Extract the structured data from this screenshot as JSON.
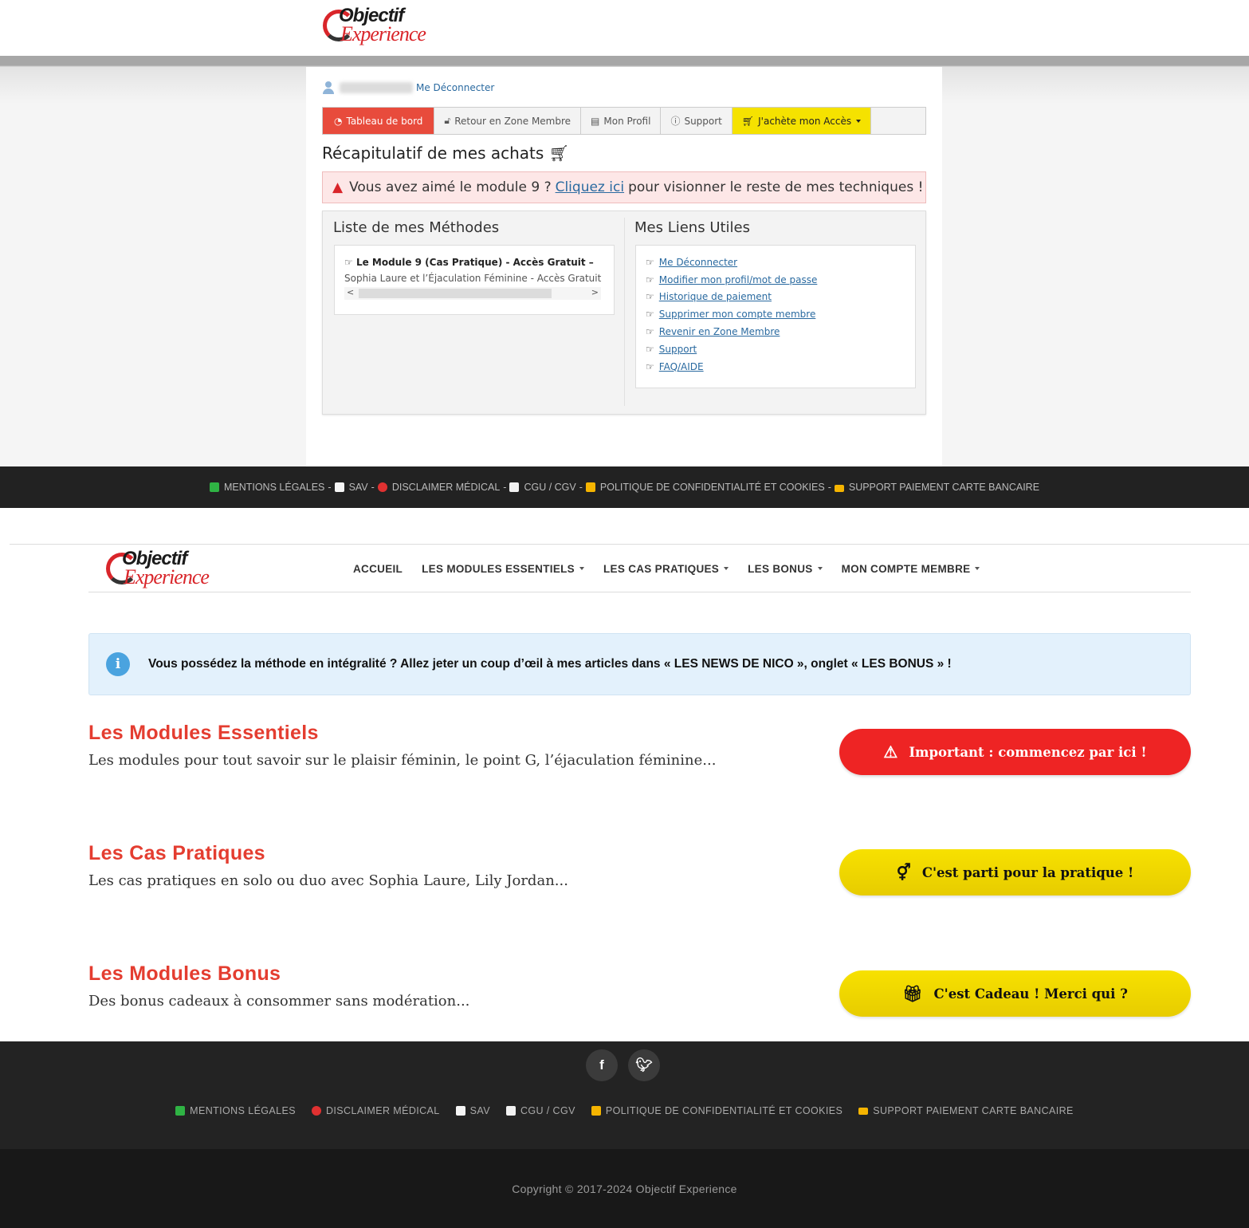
{
  "brand": {
    "logo_word1": "Objectif",
    "logo_word2": "Experience",
    "accent_color": "#e43d30"
  },
  "member_area": {
    "user": {
      "logout_label": "Me Déconnecter"
    },
    "tabs": [
      {
        "label": "Tableau de bord",
        "icon": "dashboard-icon",
        "active": true
      },
      {
        "label": "Retour en Zone Membre",
        "icon": "lock-icon"
      },
      {
        "label": "Mon Profil",
        "icon": "id-card-icon"
      },
      {
        "label": "Support",
        "icon": "help-icon"
      },
      {
        "label": "J'achète mon Accès",
        "icon": "cart-icon",
        "dropdown": true
      }
    ],
    "recap_title": "Récapitulatif de mes achats",
    "alert": {
      "before": "Vous avez aimé le module 9 ?",
      "link": "Cliquez ici",
      "after": "pour visionner le reste de mes techniques !"
    },
    "methods": {
      "title": "Liste de mes Méthodes",
      "item_title": "Le Module 9 (Cas Pratique) - Accès Gratuit –",
      "item_sub": "Sophia Laure et l’Éjaculation Féminine - Accès Gratuit"
    },
    "links": {
      "title": "Mes Liens Utiles",
      "items": [
        "Me Déconnecter",
        "Modifier mon profil/mot de passe",
        "Historique de paiement",
        "Supprimer mon compte membre",
        "Revenir en Zone Membre",
        "Support",
        "FAQ/AIDE"
      ]
    }
  },
  "footer_top": {
    "links": [
      {
        "label": "MENTIONS LÉGALES",
        "color": "#2fb344"
      },
      {
        "label": "SAV",
        "color": "#ffffff"
      },
      {
        "label": "DISCLAIMER MÉDICAL",
        "color": "#e03131"
      },
      {
        "label": "CGU / CGV",
        "color": "#f1f1f1"
      },
      {
        "label": "POLITIQUE DE CONFIDENTIALITÉ ET COOKIES",
        "color": "#f5b400"
      },
      {
        "label": "SUPPORT PAIEMENT CARTE BANCAIRE",
        "color": "#f5b400"
      }
    ]
  },
  "nav": {
    "items": [
      {
        "label": "ACCUEIL",
        "dropdown": false
      },
      {
        "label": "LES MODULES ESSENTIELS",
        "dropdown": true
      },
      {
        "label": "LES CAS PRATIQUES",
        "dropdown": true
      },
      {
        "label": "LES BONUS",
        "dropdown": true
      },
      {
        "label": "MON COMPTE MEMBRE",
        "dropdown": true
      }
    ]
  },
  "info_banner": "Vous possédez la méthode en intégralité ? Allez jeter un coup d’œil à mes articles dans « LES NEWS DE NICO », onglet « LES BONUS » !",
  "sections": [
    {
      "title": "Les Modules Essentiels",
      "desc": "Les modules pour tout savoir sur le plaisir féminin, le point G, l’éjaculation féminine...",
      "button": "Important : commencez par ici !",
      "button_icon": "warning-icon",
      "button_color": "#ee2424"
    },
    {
      "title": "Les Cas Pratiques",
      "desc": "Les cas pratiques en solo ou duo avec Sophia Laure, Lily Jordan...",
      "button": "C'est parti pour la pratique !",
      "button_icon": "gender-icon",
      "button_color": "#f0d800"
    },
    {
      "title": "Les Modules Bonus",
      "desc": "Des bonus cadeaux à consommer sans modération...",
      "button": "C'est Cadeau ! Merci qui ?",
      "button_icon": "gift-icon",
      "button_color": "#f0d800"
    }
  ],
  "footer_bottom": {
    "socials": [
      "facebook-icon",
      "twitter-icon"
    ],
    "links": [
      {
        "label": "MENTIONS LÉGALES",
        "color": "#2fb344"
      },
      {
        "label": "DISCLAIMER MÉDICAL",
        "color": "#e03131"
      },
      {
        "label": "SAV",
        "color": "#ffffff"
      },
      {
        "label": "CGU / CGV",
        "color": "#f1f1f1"
      },
      {
        "label": "POLITIQUE DE CONFIDENTIALITÉ ET COOKIES",
        "color": "#f5b400"
      },
      {
        "label": "SUPPORT PAIEMENT CARTE BANCAIRE",
        "color": "#f5b400"
      }
    ],
    "copyright": "Copyright © 2017-2024 Objectif Experience"
  }
}
